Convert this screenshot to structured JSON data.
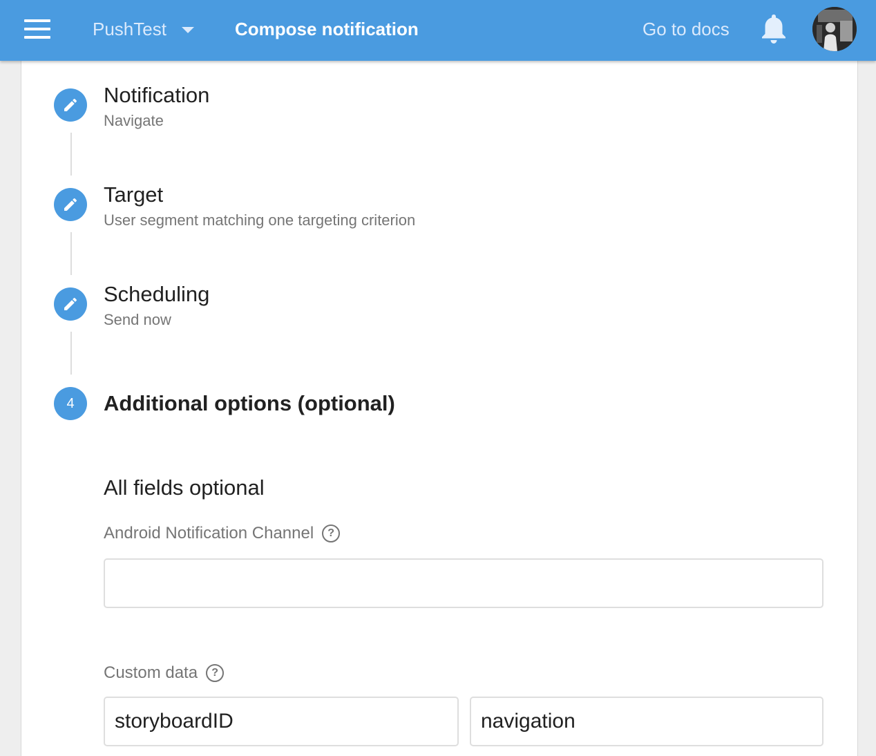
{
  "app_bar": {
    "project_name": "PushTest",
    "page_title": "Compose notification",
    "docs_link": "Go to docs",
    "colors": {
      "bar": "#4a9be0",
      "text": "#ffffff"
    },
    "icons": {
      "menu": "menu-icon",
      "project_dropdown": "caret-down-icon",
      "notifications": "bell-icon",
      "account": "avatar"
    }
  },
  "steps": [
    {
      "icon": "pencil-icon",
      "title": "Notification",
      "summary": "Navigate"
    },
    {
      "icon": "pencil-icon",
      "title": "Target",
      "summary": "User segment matching one targeting criterion"
    },
    {
      "icon": "pencil-icon",
      "title": "Scheduling",
      "summary": "Send now"
    },
    {
      "number": "4",
      "title": "Additional options (optional)"
    }
  ],
  "options": {
    "heading": "All fields optional",
    "android_channel": {
      "label": "Android Notification Channel",
      "help_icon": "help-icon",
      "value": ""
    },
    "custom_data": {
      "label": "Custom data",
      "help_icon": "help-icon",
      "key": "storyboardID",
      "value": "navigation"
    }
  }
}
